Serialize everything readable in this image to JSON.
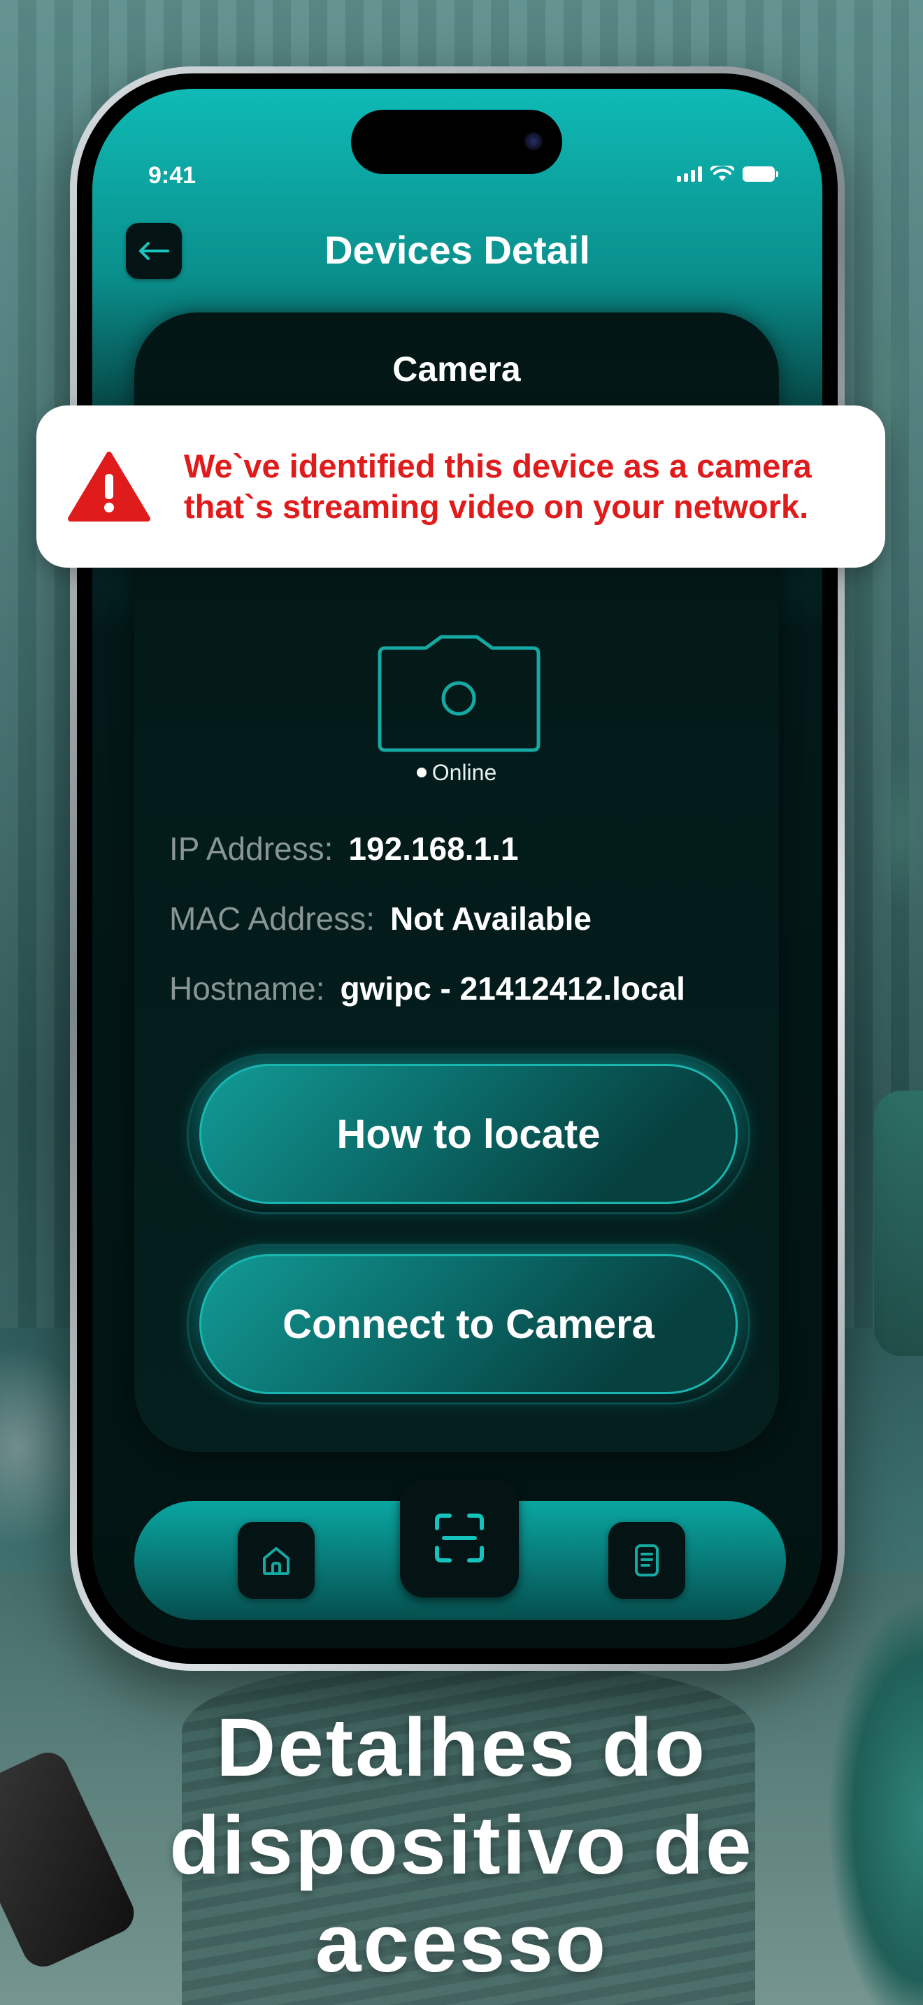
{
  "status_bar": {
    "time": "9:41"
  },
  "header": {
    "title": "Devices Detail",
    "back_icon": "arrow-left-icon"
  },
  "device": {
    "type_title": "Camera",
    "icon": "camera-icon",
    "status": "Online",
    "info": [
      {
        "label": "IP Address:",
        "value": "192.168.1.1"
      },
      {
        "label": "MAC Address:",
        "value": "Not Available"
      },
      {
        "label": "Hostname:",
        "value": "gwipc - 21412412.local"
      }
    ]
  },
  "actions": {
    "locate_label": "How to locate",
    "connect_label": "Connect to Camera"
  },
  "alert": {
    "line1": "We`ve identified this device as a camera",
    "line2": "that`s streaming video on your network.",
    "icon": "warning-icon",
    "color": "#e01b1b"
  },
  "tabbar": {
    "home_icon": "home-icon",
    "scan_icon": "scan-icon",
    "history_icon": "document-icon"
  },
  "caption": {
    "line1": "Detalhes do",
    "line2": "dispositivo de",
    "line3": "acesso"
  },
  "colors": {
    "accent": "#0fbab5",
    "card_bg": "#031b1a",
    "alert_red": "#e01b1b"
  }
}
